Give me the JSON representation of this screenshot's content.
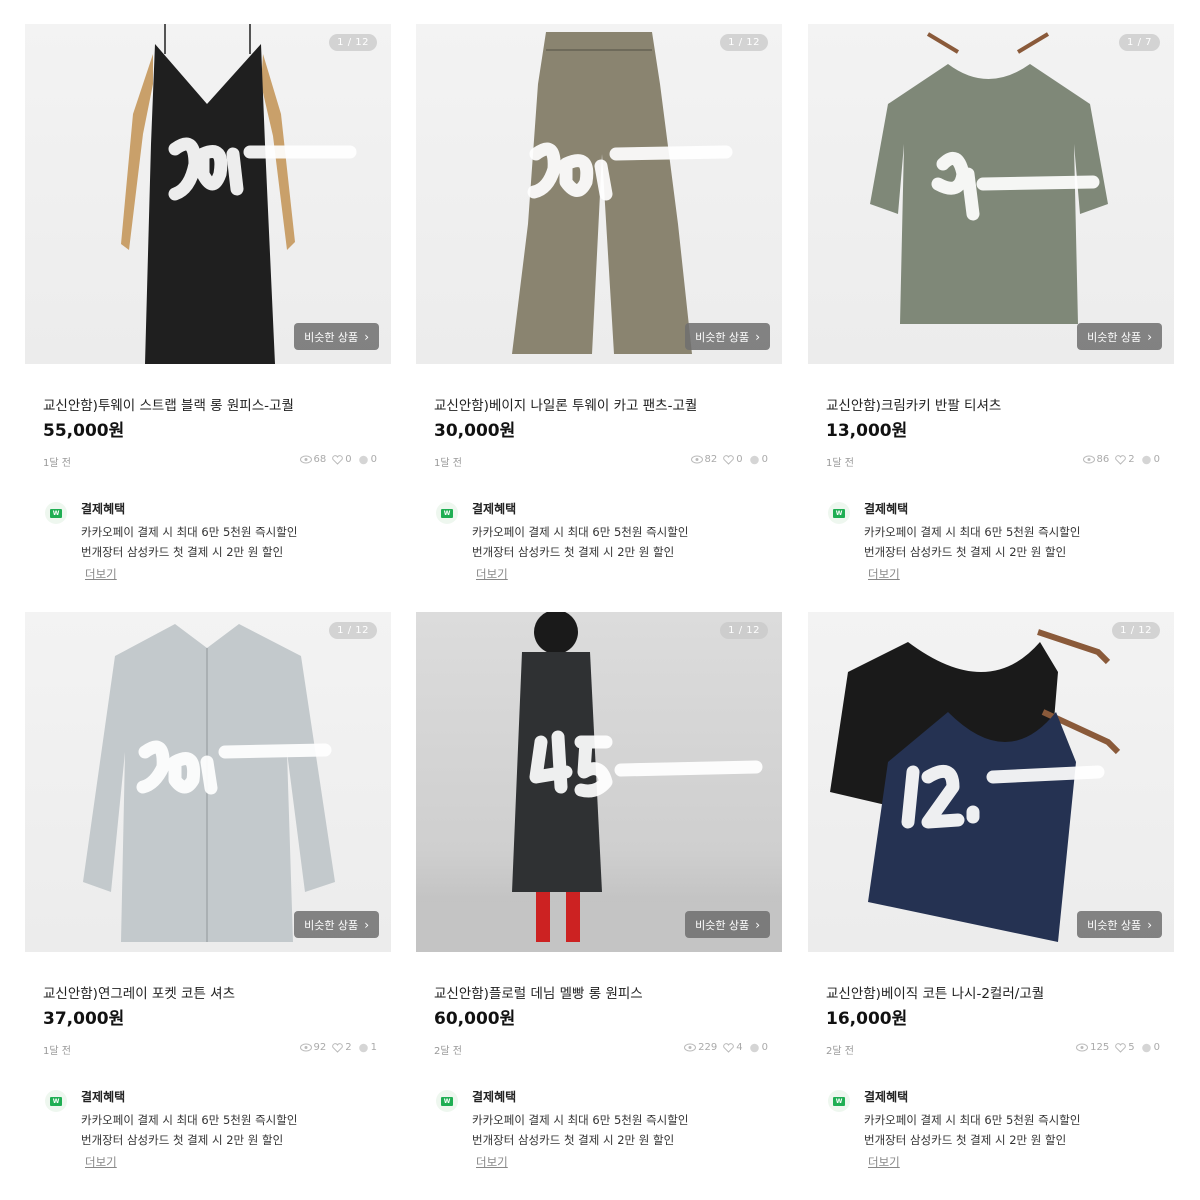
{
  "similar_label": "비슷한 상품",
  "benefit": {
    "heading": "결제혜택",
    "line1": "카카오페이 결제 시 최대 6만 5천원 즉시할인",
    "line2": "번개장터 삼성카드 첫 결제 시 2만 원  할인",
    "more": "더보기",
    "logo_text": "W",
    "logo_color": "#1fae53"
  },
  "products": [
    {
      "counter": "1 / 12",
      "title": "교신안함)투웨이 스트랩 블랙 롱 원피스-고퀄",
      "price": "55,000원",
      "time": "1달 전",
      "views": "68",
      "likes": "0",
      "chats": "0",
      "garment_color": "#1f1f1f",
      "icon": "dress-image"
    },
    {
      "counter": "1 / 12",
      "title": "교신안함)베이지 나일론 투웨이 카고 팬츠-고퀄",
      "price": "30,000원",
      "time": "1달 전",
      "views": "82",
      "likes": "0",
      "chats": "0",
      "garment_color": "#8a8470",
      "icon": "pants-image"
    },
    {
      "counter": "1 / 7",
      "title": "교신안함)크림카키 반팔 티셔츠",
      "price": "13,000원",
      "time": "1달 전",
      "views": "86",
      "likes": "2",
      "chats": "0",
      "garment_color": "#7f8878",
      "icon": "tshirt-image"
    },
    {
      "counter": "1 / 12",
      "title": "교신안함)연그레이 포켓 코튼 셔츠",
      "price": "37,000원",
      "time": "1달 전",
      "views": "92",
      "likes": "2",
      "chats": "1",
      "garment_color": "#c3c9cc",
      "icon": "shirt-image"
    },
    {
      "counter": "1 / 12",
      "title": "교신안함)플로럴 데님 멜빵 롱 원피스",
      "price": "60,000원",
      "time": "2달 전",
      "views": "229",
      "likes": "4",
      "chats": "0",
      "garment_color": "#2f3133",
      "icon": "overall-image"
    },
    {
      "counter": "1 / 12",
      "title": "교신안함)베이직 코튼 나시-2컬러/고퀄",
      "price": "16,000원",
      "time": "2달 전",
      "views": "125",
      "likes": "5",
      "chats": "0",
      "garment_color": "#253252",
      "icon": "tanktop-image"
    }
  ]
}
